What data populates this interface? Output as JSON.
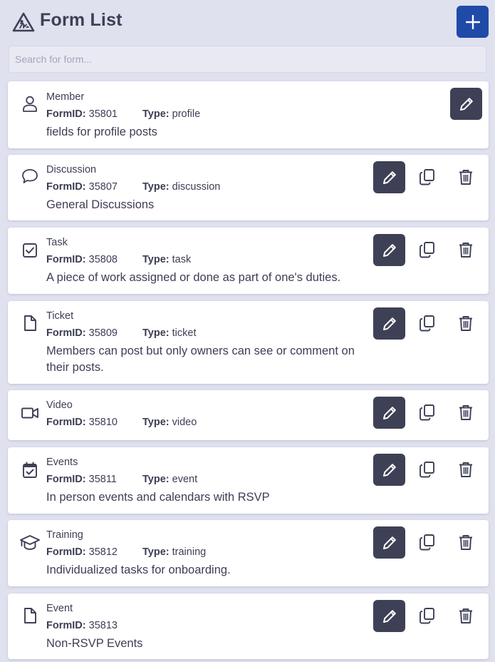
{
  "header": {
    "title": "Form List",
    "logo_icon": "warning-triangle-worker-icon",
    "add_icon": "plus-icon"
  },
  "search": {
    "placeholder": "Search for form...",
    "value": ""
  },
  "labels": {
    "form_id": "FormID:",
    "type": "Type:"
  },
  "forms": [
    {
      "name": "Member",
      "id": "35801",
      "type": "profile",
      "description": "fields for profile posts",
      "icon": "user-icon"
    },
    {
      "name": "Discussion",
      "id": "35807",
      "type": "discussion",
      "description": "General Discussions",
      "icon": "chat-bubble-icon"
    },
    {
      "name": "Task",
      "id": "35808",
      "type": "task",
      "description": "A piece of work assigned or done as part of one's duties.",
      "icon": "checkbox-icon"
    },
    {
      "name": "Ticket",
      "id": "35809",
      "type": "ticket",
      "description": "Members can post but only owners can see or comment on their posts.",
      "icon": "file-icon"
    },
    {
      "name": "Video",
      "id": "35810",
      "type": "video",
      "description": "",
      "icon": "video-camera-icon"
    },
    {
      "name": "Events",
      "id": "35811",
      "type": "event",
      "description": "In person events and calendars with RSVP",
      "icon": "calendar-check-icon"
    },
    {
      "name": "Training",
      "id": "35812",
      "type": "training",
      "description": "Individualized tasks for onboarding.",
      "icon": "graduation-cap-icon"
    },
    {
      "name": "Event",
      "id": "35813",
      "type": "",
      "description": "Non-RSVP Events",
      "icon": "file-icon"
    }
  ],
  "colors": {
    "background": "#dfe1ef",
    "primary": "#1f4aa8",
    "dark": "#3e4056",
    "card": "#ffffff"
  }
}
